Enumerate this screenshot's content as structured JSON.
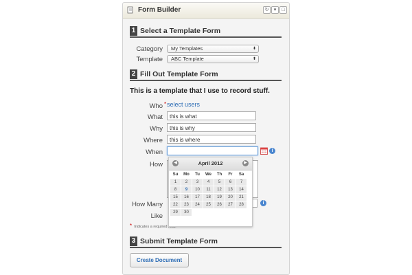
{
  "window": {
    "title": "Form Builder"
  },
  "sections": [
    {
      "number": "1",
      "title": "Select a Template Form"
    },
    {
      "number": "2",
      "title": "Fill Out Template Form"
    },
    {
      "number": "3",
      "title": "Submit Template Form"
    }
  ],
  "template_select": {
    "category_label": "Category",
    "category_value": "My Templates",
    "template_label": "Template",
    "template_value": "ABC Template"
  },
  "form": {
    "description": "This is a template that I use to record stuff.",
    "who_label": "Who",
    "who_required_mark": "*",
    "who_link": "select users",
    "what_label": "What",
    "what_value": "this is what",
    "why_label": "Why",
    "why_value": "this is why",
    "where_label": "Where",
    "where_value": "this is where",
    "when_label": "When",
    "when_value": "",
    "how_label": "How",
    "how_many_label": "How Many",
    "like_label": "Like",
    "required_note_mark": "*",
    "required_note": "Indicates a required field."
  },
  "calendar": {
    "month_label": "April 2012",
    "days_of_week": [
      "Su",
      "Mo",
      "Tu",
      "We",
      "Th",
      "Fr",
      "Sa"
    ],
    "weeks": [
      [
        "",
        "1",
        "2",
        "3",
        "4",
        "5",
        "6",
        "7"
      ],
      [
        "8",
        "9",
        "10",
        "11",
        "12",
        "13",
        "14"
      ],
      [
        "15",
        "16",
        "17",
        "18",
        "19",
        "20",
        "21"
      ],
      [
        "22",
        "23",
        "24",
        "25",
        "26",
        "27",
        "28"
      ],
      [
        "29",
        "30",
        "",
        "",
        "",
        "",
        ""
      ]
    ],
    "today": "9"
  },
  "submit": {
    "button_label": "Create Document"
  },
  "icons": {
    "window_icon": "document-icon",
    "calendar_icon": "calendar-icon",
    "info_icon": "info-icon"
  },
  "colors": {
    "accent": "#2d6db5",
    "info": "#4a86cf",
    "required": "#cc0000"
  }
}
